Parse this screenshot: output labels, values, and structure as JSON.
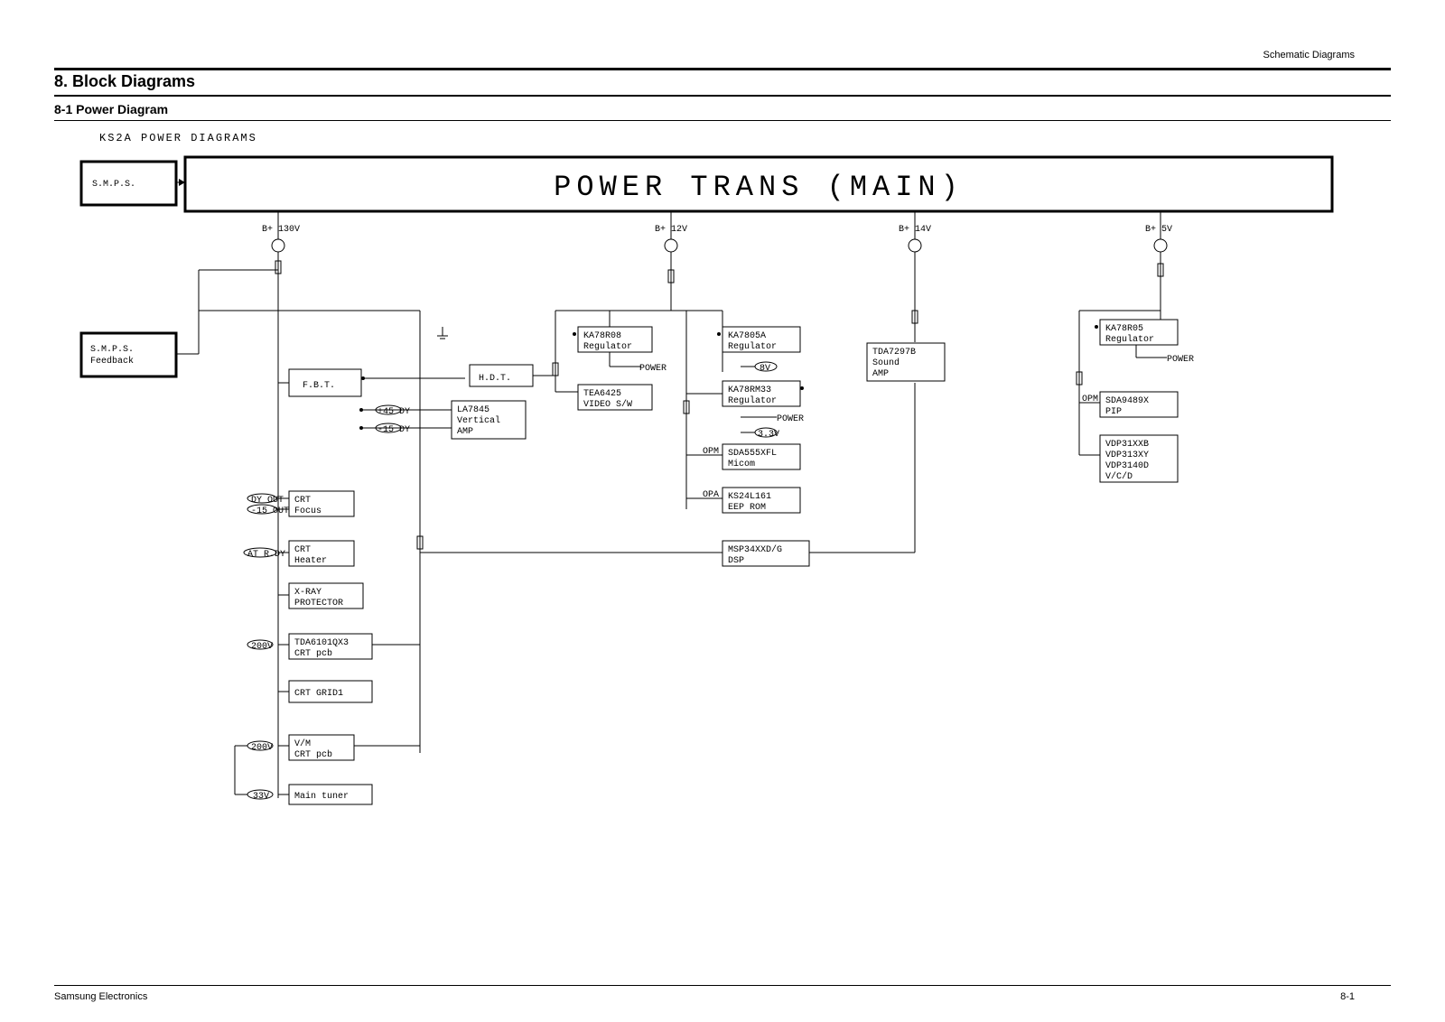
{
  "header": {
    "doc_section_label": "Schematic Diagrams",
    "section_number_title": "8. Block Diagrams",
    "subsection_title": "8-1 Power Diagram",
    "diagram_caption": "KS2A POWER DIAGRAMS"
  },
  "main_title": "POWER TRANS (MAIN)",
  "rails": {
    "b_130v": "B+ 130V",
    "b_12v": "B+ 12V",
    "b_14v": "B+ 14V",
    "b_5v": "B+ 5V"
  },
  "blocks": {
    "smps": "S.M.P.S.",
    "smps_feedback_1": "S.M.P.S.",
    "smps_feedback_2": "Feedback",
    "fbt": "F.B.T.",
    "hdt": "H.D.T.",
    "la7845_1": "LA7845",
    "la7845_2": "Vertical",
    "la7845_3": "AMP",
    "ka78r08_1": "KA78R08",
    "ka78r08_2": "Regulator",
    "tea6425_1": "TEA6425",
    "tea6425_2": "VIDEO S/W",
    "ka7805a_1": "KA7805A",
    "ka7805a_2": "Regulator",
    "ka78rm33_1": "KA78RM33",
    "ka78rm33_2": "Regulator",
    "sda555xfl_1": "SDA555XFL",
    "sda555xfl_2": "Micom",
    "ks24l161_1": "KS24L161",
    "ks24l161_2": "EEP ROM",
    "msp34_1": "MSP34XXD/G",
    "msp34_2": "DSP",
    "tda7297b_1": "TDA7297B",
    "tda7297b_2": "Sound",
    "tda7297b_3": "AMP",
    "ka78r05_1": "KA78R05",
    "ka78r05_2": "Regulator",
    "sda9489x_1": "SDA9489X",
    "sda9489x_2": "PIP",
    "vdp_1": "VDP31XXB",
    "vdp_2": "VDP313XY",
    "vdp_3": "VDP3140D",
    "vdp_4": "V/C/D",
    "crt_focus_1": "CRT",
    "crt_focus_2": "Focus",
    "crt_heater_1": "CRT",
    "crt_heater_2": "Heater",
    "xray_1": "X-RAY",
    "xray_2": "PROTECTOR",
    "tda6101_1": "TDA6101QX3",
    "tda6101_2": "CRT pcb",
    "crt_grid1": "CRT GRID1",
    "vm_1": "V/M",
    "vm_2": "CRT pcb",
    "main_tuner": "Main tuner"
  },
  "tags": {
    "fuse_45": "+45 DY",
    "fuse_15": "-15 DY",
    "focus_a": "DY OUT",
    "focus_b": "-15 OUT",
    "heater": "AT R.DY",
    "tda6101": "200V",
    "vm": "200V",
    "tuner": "33V",
    "sw_8v": "8V",
    "sw_3p3": "3.3V",
    "power_a": "POWER",
    "power_b": "POWER",
    "power_c": "POWER",
    "op_a": "OPM",
    "op_b": "OPM",
    "op_c": "OPA"
  },
  "footer": {
    "left": "Samsung Electronics",
    "right": "8-1"
  }
}
